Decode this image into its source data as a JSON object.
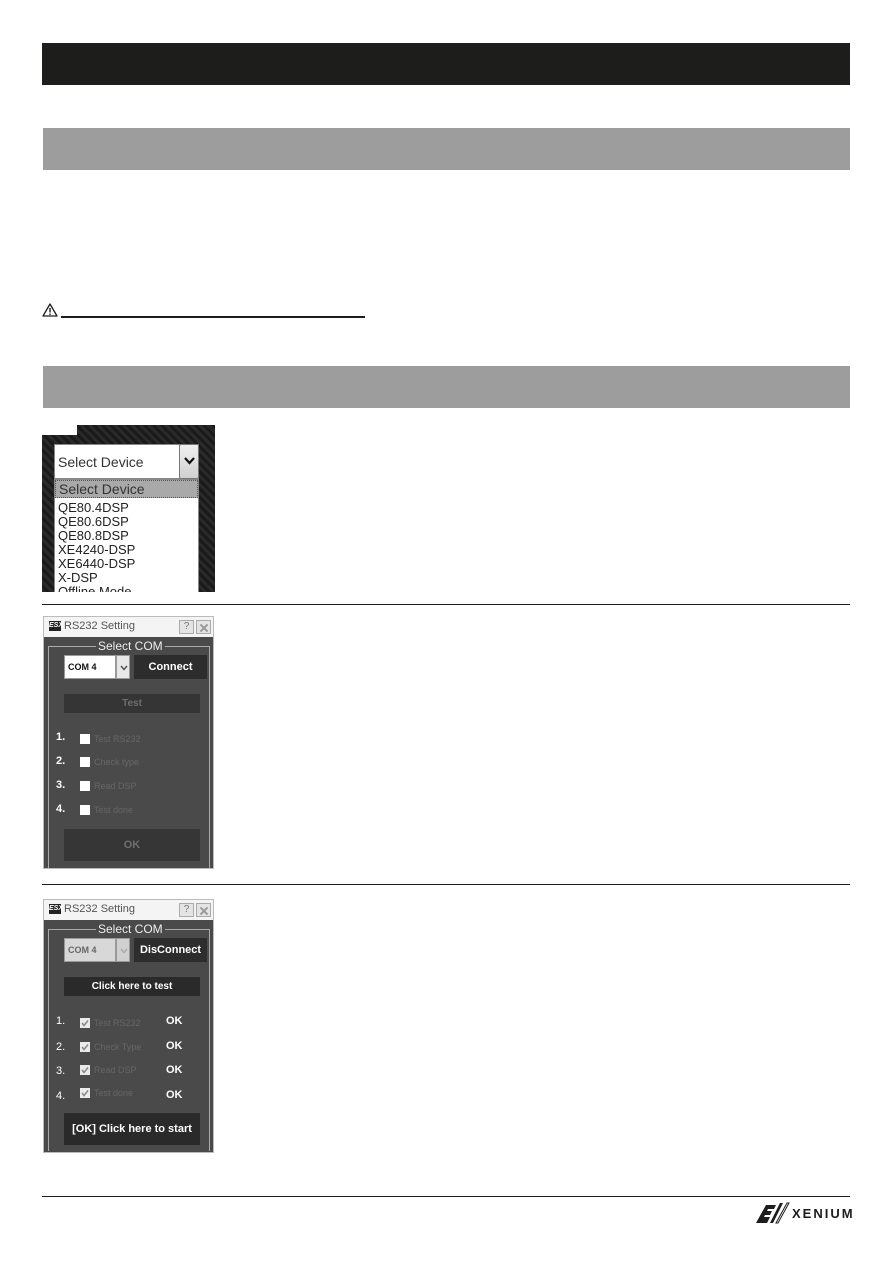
{
  "device_select": {
    "current": "Select Device",
    "options": [
      "Select Device",
      "QE80.4DSP",
      "QE80.6DSP",
      "QE80.8DSP",
      "XE4240-DSP",
      "XE6440-DSP",
      "X-DSP",
      "Offline Mode"
    ]
  },
  "dialog_before": {
    "title": "RS232 Setting",
    "help_label": "?",
    "group_title": "Select COM",
    "com_value": "COM 4",
    "connect_label": "Connect",
    "test_label": "Test",
    "steps": [
      {
        "num": "1.",
        "label": "Test RS232",
        "checked": false,
        "status": ""
      },
      {
        "num": "2.",
        "label": "Check type",
        "checked": false,
        "status": ""
      },
      {
        "num": "3.",
        "label": "Read DSP",
        "checked": false,
        "status": ""
      },
      {
        "num": "4.",
        "label": "Test done",
        "checked": false,
        "status": ""
      }
    ],
    "ok_label": "OK"
  },
  "dialog_after": {
    "title": "RS232 Setting",
    "help_label": "?",
    "group_title": "Select COM",
    "com_value": "COM 4",
    "connect_label": "DisConnect",
    "test_label": "Click here to test",
    "steps": [
      {
        "num": "1.",
        "label": "Test RS232",
        "checked": true,
        "status": "OK"
      },
      {
        "num": "2.",
        "label": "Check Type",
        "checked": true,
        "status": "OK"
      },
      {
        "num": "3.",
        "label": "Read DSP",
        "checked": true,
        "status": "OK"
      },
      {
        "num": "4.",
        "label": "Test done",
        "checked": true,
        "status": "OK"
      }
    ],
    "ok_label": "[OK] Click here to start"
  },
  "footer": {
    "brand": "XENIUM"
  },
  "colors": {
    "header_bar": "#1d1d1b",
    "section_bar": "#9d9d9d",
    "dialog_bg": "#4a4a4a"
  }
}
